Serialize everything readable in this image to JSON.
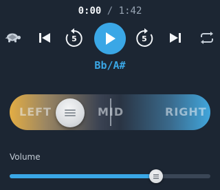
{
  "player": {
    "current_time": "0:00",
    "separator": "/",
    "total_time": "1:42",
    "skip_back_seconds": "5",
    "skip_forward_seconds": "5",
    "key": "Bb/A#"
  },
  "balance": {
    "left_label": "LEFT",
    "mid_label": "MID",
    "right_label": "RIGHT",
    "position": 0.3
  },
  "volume": {
    "label": "Volume",
    "level": 0.73
  },
  "colors": {
    "accent": "#3aa7e6",
    "background": "#1c2633",
    "balance_left": "#e3ad44",
    "balance_right": "#41a6dc"
  },
  "icons": [
    "turtle-icon",
    "skip-previous-icon",
    "replay-5-icon",
    "play-icon",
    "forward-5-icon",
    "skip-next-icon",
    "repeat-icon"
  ]
}
